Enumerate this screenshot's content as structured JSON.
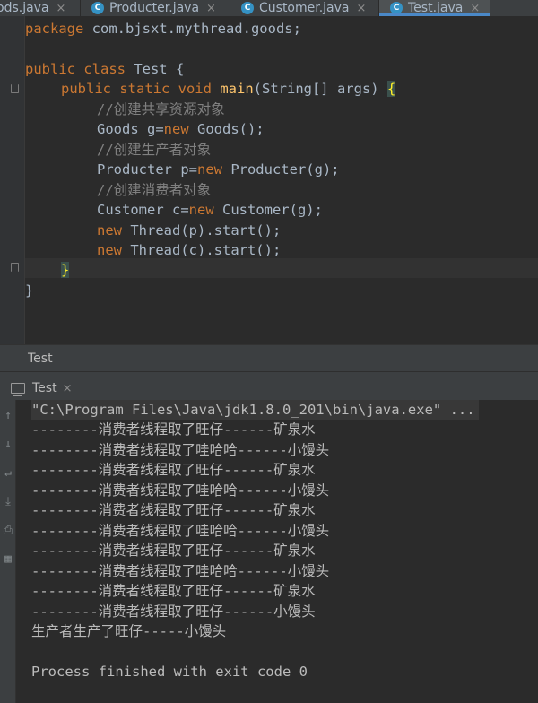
{
  "editor_tabs": [
    {
      "label": "ods.java",
      "active": false
    },
    {
      "label": "Producter.java",
      "active": false
    },
    {
      "label": "Customer.java",
      "active": false
    },
    {
      "label": "Test.java",
      "active": true
    }
  ],
  "icons": {
    "class_icon_letter": "C",
    "close_glyph": "×"
  },
  "code": {
    "line_package_kw": "package",
    "line_package_rest": " com.bjsxt.mythread.goods;",
    "line_class_kw": "public class",
    "line_class_rest": " Test {",
    "line_main_kw": "public static void",
    "line_main_fn": "main",
    "line_main_rest": "(String[] args) ",
    "line_main_brace": "{",
    "comment_goods": "//创建共享资源对象",
    "line_goods_a": "Goods g=",
    "kw_new": "new",
    "line_goods_b": " Goods();",
    "comment_producer": "//创建生产者对象",
    "line_producer_a": "Producter p=",
    "line_producer_b": " Producter(g);",
    "comment_customer": "//创建消费者对象",
    "line_customer_a": "Customer c=",
    "line_customer_b": " Customer(g);",
    "line_thread_p": " Thread(p).start();",
    "line_thread_c": " Thread(c).start();",
    "close_brace": "}"
  },
  "run_panel": {
    "title": "Test",
    "tab_label": "Test"
  },
  "console": {
    "command": "\"C:\\Program Files\\Java\\jdk1.8.0_201\\bin\\java.exe\" ...",
    "lines": [
      "--------消费者线程取了旺仔------矿泉水",
      "--------消费者线程取了哇哈哈------小馒头",
      "--------消费者线程取了旺仔------矿泉水",
      "--------消费者线程取了哇哈哈------小馒头",
      "--------消费者线程取了旺仔------矿泉水",
      "--------消费者线程取了哇哈哈------小馒头",
      "--------消费者线程取了旺仔------矿泉水",
      "--------消费者线程取了哇哈哈------小馒头",
      "--------消费者线程取了旺仔------矿泉水",
      "--------消费者线程取了旺仔------小馒头",
      "生产者生产了旺仔-----小馒头"
    ],
    "exit_message": "Process finished with exit code 0"
  },
  "colors": {
    "keyword": "#cc7832",
    "function": "#ffc66d",
    "comment": "#808080",
    "text": "#a9b7c6",
    "accent": "#4a88c7"
  }
}
